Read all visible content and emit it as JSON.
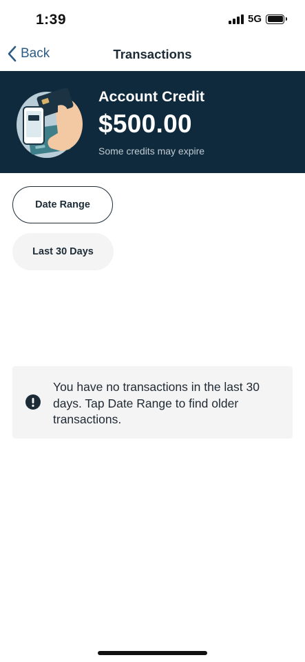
{
  "status_bar": {
    "time": "1:39",
    "network": "5G",
    "icons": [
      "signal-icon",
      "battery-icon"
    ]
  },
  "nav": {
    "back_label": "Back",
    "title": "Transactions"
  },
  "credit": {
    "title": "Account Credit",
    "amount": "$500.00",
    "note": "Some credits may expire",
    "illustration": "payment-illustration"
  },
  "filters": {
    "date_range_label": "Date Range",
    "range_label": "Last 30 Days"
  },
  "empty_state": {
    "icon": "info-icon",
    "message": "You have no transactions in the last 30 days. Tap Date Range to find older transactions."
  },
  "colors": {
    "banner": "#0e2a3c",
    "accent": "#2c5b86",
    "chip_bg": "#f4f4f4"
  }
}
